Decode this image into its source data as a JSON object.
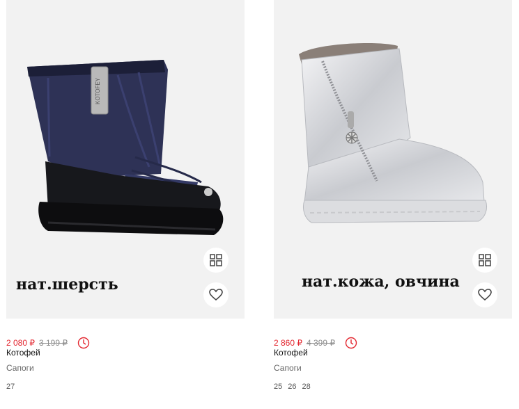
{
  "products": [
    {
      "overlay_text": "нат.шерсть",
      "price": "2 080 ₽",
      "old_price": "3 199 ₽",
      "brand": "Котофей",
      "category": "Сапоги",
      "sizes": [
        "27"
      ],
      "boot_label": "KOTOFEY",
      "image": "navy-winter-boot"
    },
    {
      "overlay_text": "нат.кожа, овчина",
      "price": "2 860 ₽",
      "old_price": "4 399 ₽",
      "brand": "Котофей",
      "category": "Сапоги",
      "sizes": [
        "25",
        "26",
        "28"
      ],
      "image": "silver-leather-boot"
    }
  ],
  "icons": {
    "compare": "compare-icon",
    "favorite": "heart-icon",
    "discount_timer": "clock-icon"
  },
  "colors": {
    "price": "#e3262f",
    "old_price": "#8e8e8e",
    "photo_bg": "#f2f2f2"
  }
}
